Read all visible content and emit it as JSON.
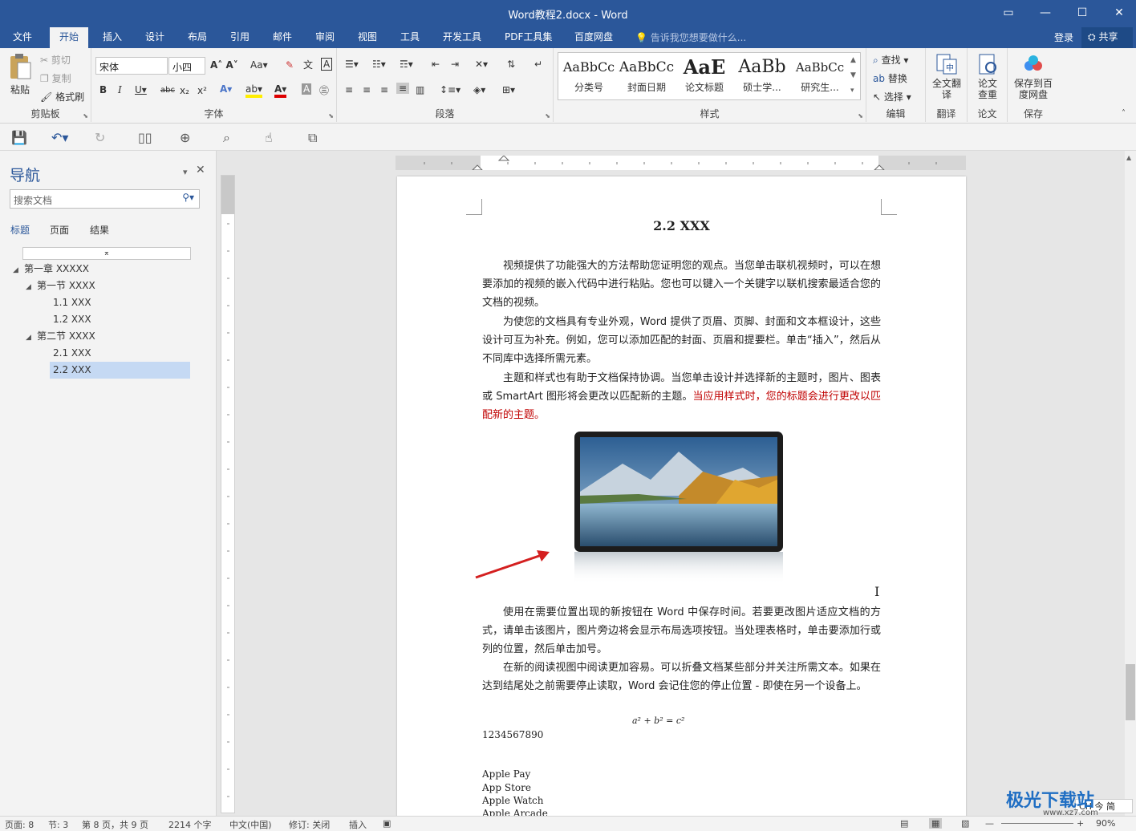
{
  "window": {
    "title": "Word教程2.docx - Word",
    "controls": {
      "ribbon_display": "▭",
      "minimize": "—",
      "maximize": "☐",
      "close": "✕"
    }
  },
  "menu": {
    "tabs": [
      "文件",
      "开始",
      "插入",
      "设计",
      "布局",
      "引用",
      "邮件",
      "审阅",
      "视图",
      "工具",
      "开发工具",
      "PDF工具集",
      "百度网盘"
    ],
    "active": "开始",
    "tell_me": "告诉我您想要做什么...",
    "login": "登录",
    "share": "共享"
  },
  "ribbon": {
    "clipboard": {
      "label": "剪贴板",
      "paste": "粘贴",
      "cut": "剪切",
      "copy": "复制",
      "format_painter": "格式刷"
    },
    "font": {
      "label": "字体",
      "font_name": "宋体",
      "font_size": "小四"
    },
    "paragraph": {
      "label": "段落"
    },
    "styles": {
      "label": "样式",
      "items": [
        {
          "preview": "AaBbCc",
          "name": "分类号"
        },
        {
          "preview": "AaBbCc",
          "name": "封面日期"
        },
        {
          "preview": "AaE",
          "name": "论文标题"
        },
        {
          "preview": "AaBb",
          "name": "硕士学..."
        },
        {
          "preview": "AaBbCc",
          "name": "研究生..."
        }
      ]
    },
    "editing": {
      "label": "编辑",
      "find": "查找",
      "replace": "替换",
      "select": "选择"
    },
    "translate": {
      "label": "翻译",
      "full_text": "全文翻译"
    },
    "paper": {
      "label": "论文",
      "check": "论文查重"
    },
    "save": {
      "label": "保存",
      "save_to": "保存到百度网盘"
    }
  },
  "nav": {
    "title": "导航",
    "search_placeholder": "搜索文档",
    "tabs": [
      "标题",
      "页面",
      "结果"
    ],
    "tree": [
      {
        "label": "第一章 XXXXX",
        "level": 0,
        "twisty": "◢"
      },
      {
        "label": "第一节 XXXX",
        "level": 1,
        "twisty": "◢"
      },
      {
        "label": "1.1 XXX",
        "level": 2,
        "twisty": ""
      },
      {
        "label": "1.2 XXX",
        "level": 2,
        "twisty": ""
      },
      {
        "label": "第二节 XXXX",
        "level": 1,
        "twisty": "◢"
      },
      {
        "label": "2.1 XXX",
        "level": 2,
        "twisty": ""
      },
      {
        "label": "2.2 XXX",
        "level": 2,
        "twisty": "",
        "selected": true
      }
    ]
  },
  "document": {
    "heading": "2.2 XXX",
    "p1": "视频提供了功能强大的方法帮助您证明您的观点。当您单击联机视频时，可以在想要添加的视频的嵌入代码中进行粘贴。您也可以键入一个关键字以联机搜索最适合您的文档的视频。",
    "p2": "为使您的文档具有专业外观，Word 提供了页眉、页脚、封面和文本框设计，这些设计可互为补充。例如，您可以添加匹配的封面、页眉和提要栏。单击“插入”，然后从不同库中选择所需元素。",
    "p3_black": "主题和样式也有助于文档保持协调。当您单击设计并选择新的主题时，图片、图表或 SmartArt 图形将会更改以匹配新的主题。",
    "p3_red": "当应用样式时，您的标题会进行更改以匹配新的主题。",
    "p4": "使用在需要位置出现的新按钮在 Word 中保存时间。若要更改图片适应文档的方式，请单击该图片，图片旁边将会显示布局选项按钮。当处理表格时，单击要添加行或列的位置，然后单击加号。",
    "p5": "在新的阅读视图中阅读更加容易。可以折叠文档某些部分并关注所需文本。如果在达到结尾处之前需要停止读取，Word 会记住您的停止位置 - 即使在另一个设备上。",
    "equation": "a² + b² = c²",
    "number": "1234567890",
    "list": [
      "Apple Pay",
      "App Store",
      "Apple Watch",
      "Apple Arcade"
    ]
  },
  "colors": {
    "brand": "#2b579a",
    "annotation_arrow": "#d42020",
    "highlight": "#c00000"
  },
  "status": {
    "page": "页面: 8",
    "section": "节: 3",
    "page_of": "第 8 页，共 9 页",
    "words": "2214 个字",
    "lang": "中文(中国)",
    "revision": "修订: 关闭",
    "insert": "插入",
    "zoom": "90%",
    "ime": "CH 今 简"
  },
  "watermark": {
    "text": "极光下载站",
    "url": "www.xz7.com"
  }
}
